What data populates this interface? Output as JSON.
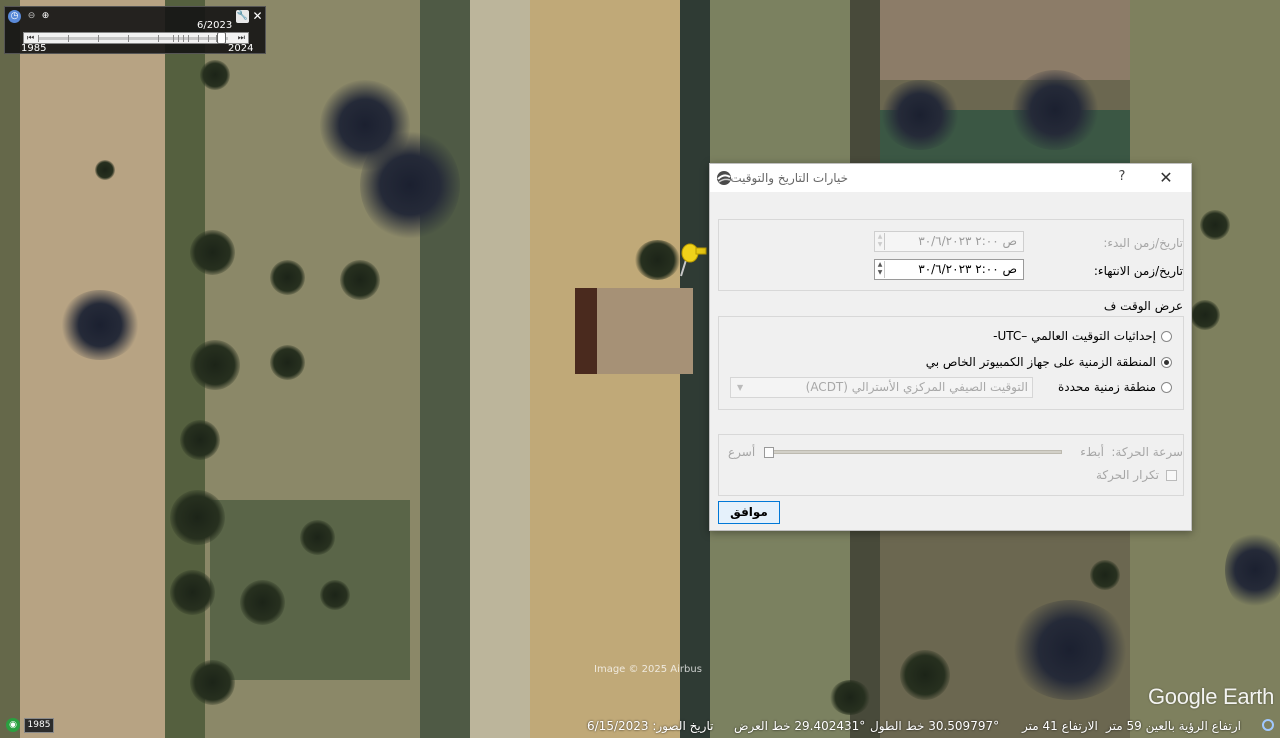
{
  "time_slider": {
    "current_date": "6/2023",
    "start_year": "1985",
    "end_year": "2024",
    "position_fraction": 0.97
  },
  "map": {
    "attribution": "Image © 2025 Airbus",
    "logo": "Google Earth"
  },
  "dialog": {
    "title": "خيارات التاريخ والتوقيت",
    "help_label": "?",
    "close_label": "✕",
    "start_label": "تاريخ/زمن البدء:",
    "start_value": "ص ٢:٠٠ ٣٠/٦/٢٠٢٣",
    "end_label": "تاريخ/زمن الانتهاء:",
    "end_value": "ص ٢:٠٠ ٣٠/٦/٢٠٢٣",
    "display_heading": "عرض الوقت ف",
    "options": [
      {
        "label": "إحداثيات التوقيت العالمي –UTC-",
        "selected": false,
        "enabled": true
      },
      {
        "label": "المنطقة الزمنية على جهاز الكمبيوتر الخاص بي",
        "selected": true,
        "enabled": true
      },
      {
        "label": "منطقة زمنية محددة",
        "selected": false,
        "enabled": true
      }
    ],
    "timezone_value": "التوقيت الصيفي المركزي الأسترالي (ACDT)",
    "speed_label": "سرعة الحركة:",
    "speed_slow": "أبطء",
    "speed_fast": "أسرع",
    "speed_fraction": 0.0,
    "repeat_label": "تكرار الحركة",
    "ok_label": "موافق"
  },
  "status_bar": {
    "year_badge": "1985",
    "imagery_date": "تاريخ الصور: 6/15/2023",
    "latitude": "29.402431° خط العرض",
    "longitude": "30.509797° خط الطول",
    "elevation": "الارتفاع 41 متر",
    "eye_altitude": "ارتفاع الرؤية بالعين 59 متر"
  }
}
